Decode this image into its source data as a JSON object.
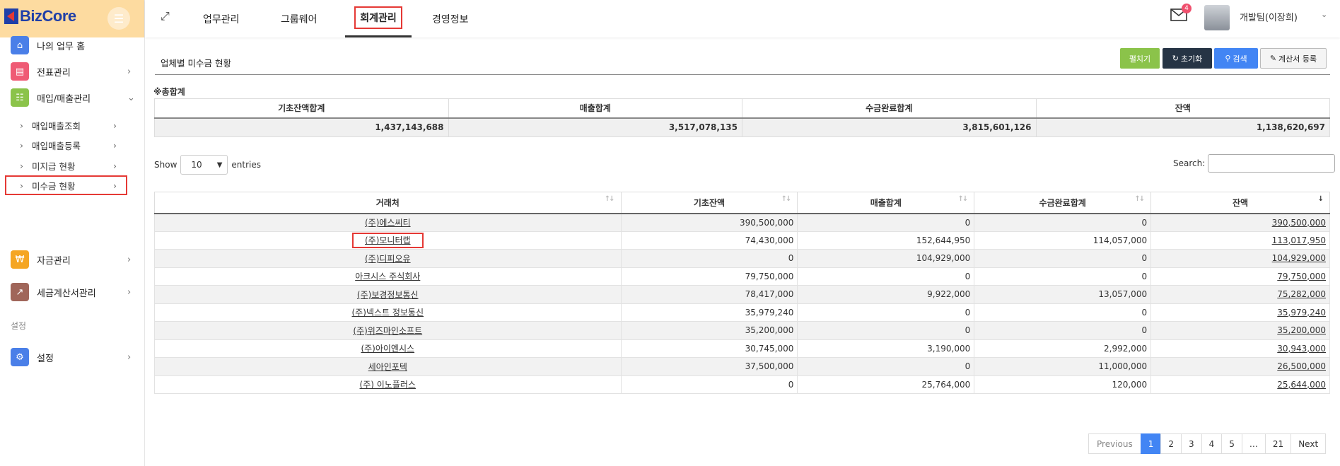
{
  "app": {
    "logo_text": "BizCore"
  },
  "topbar": {
    "nav": [
      "업무관리",
      "그룹웨어",
      "회계관리",
      "경영정보"
    ],
    "mail_badge": "4",
    "user_name": "개발팀(이장희)"
  },
  "sidebar": {
    "items": [
      {
        "label": "나의 업무 홈",
        "icon": "home-icon",
        "color": "#4a7fe8"
      },
      {
        "label": "전표관리",
        "icon": "document-icon",
        "color": "#ef5b75"
      },
      {
        "label": "매입/매출관리",
        "icon": "list-icon",
        "color": "#8bc34a"
      },
      {
        "label": "자금관리",
        "icon": "won-icon",
        "color": "#f5a623"
      },
      {
        "label": "세금계산서관리",
        "icon": "chart-icon",
        "color": "#a0665a"
      },
      {
        "label": "설정",
        "icon": "gear-icon",
        "color": "#4a7fe8"
      }
    ],
    "sub_items": [
      "매입매출조회",
      "매입매출등록",
      "미지급 현황",
      "미수금 현황"
    ],
    "section_settings": "설정"
  },
  "panel": {
    "title": "업체별 미수금 현황",
    "buttons": {
      "expand": "펼치기",
      "reset": "초기화",
      "search": "검색",
      "register": "계산서 등록"
    }
  },
  "summary": {
    "label": "※총합계",
    "headers": [
      "기초잔액합계",
      "매출합계",
      "수금완료합계",
      "잔액"
    ],
    "values": [
      "1,437,143,688",
      "3,517,078,135",
      "3,815,601,126",
      "1,138,620,697"
    ]
  },
  "table_controls": {
    "show": "Show",
    "entries_value": "10",
    "entries": "entries",
    "search_label": "Search:"
  },
  "table": {
    "headers": [
      "거래처",
      "기초잔액",
      "매출합계",
      "수금완료합계",
      "잔액"
    ],
    "rows": [
      [
        "(주)에스씨티",
        "390,500,000",
        "0",
        "0",
        "390,500,000"
      ],
      [
        "(주)모니터랩",
        "74,430,000",
        "152,644,950",
        "114,057,000",
        "113,017,950"
      ],
      [
        "(주)디피오유",
        "0",
        "104,929,000",
        "0",
        "104,929,000"
      ],
      [
        "아크시스 주식회사",
        "79,750,000",
        "0",
        "0",
        "79,750,000"
      ],
      [
        "(주)보경정보통신",
        "78,417,000",
        "9,922,000",
        "13,057,000",
        "75,282,000"
      ],
      [
        "(주)넥스트 정보통신",
        "35,979,240",
        "0",
        "0",
        "35,979,240"
      ],
      [
        "(주)위즈마인소프트",
        "35,200,000",
        "0",
        "0",
        "35,200,000"
      ],
      [
        "(주)아이엔시스",
        "30,745,000",
        "3,190,000",
        "2,992,000",
        "30,943,000"
      ],
      [
        "세아인포텍",
        "37,500,000",
        "0",
        "11,000,000",
        "26,500,000"
      ],
      [
        "(주) 이노플러스",
        "0",
        "25,764,000",
        "120,000",
        "25,644,000"
      ]
    ]
  },
  "pagination": {
    "previous": "Previous",
    "pages": [
      "1",
      "2",
      "3",
      "4",
      "5",
      "…",
      "21"
    ],
    "next": "Next"
  }
}
